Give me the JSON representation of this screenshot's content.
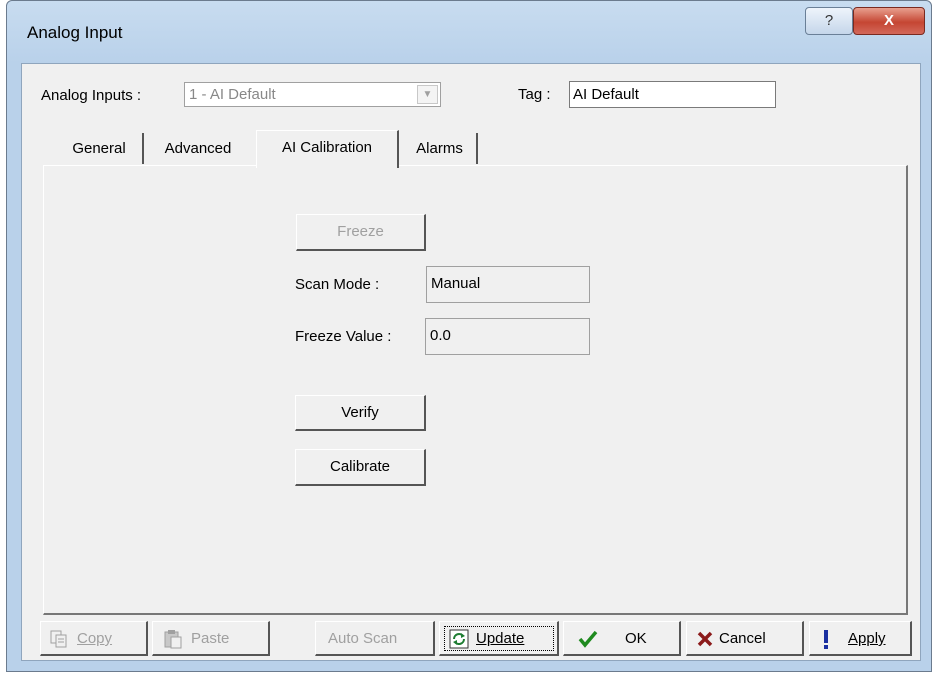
{
  "window": {
    "title": "Analog Input",
    "help_glyph": "?",
    "close_glyph": "X"
  },
  "header": {
    "analog_inputs_label": "Analog Inputs :",
    "analog_inputs_value": "1 - AI Default",
    "tag_label": "Tag :",
    "tag_value": "AI Default"
  },
  "tabs": [
    {
      "label": "General",
      "active": false
    },
    {
      "label": "Advanced",
      "active": false
    },
    {
      "label": "AI Calibration",
      "active": true
    },
    {
      "label": "Alarms",
      "active": false
    }
  ],
  "calibration": {
    "freeze_button": "Freeze",
    "scan_mode_label": "Scan Mode :",
    "scan_mode_value": "Manual",
    "freeze_value_label": "Freeze Value :",
    "freeze_value": "0.0",
    "verify_button": "Verify",
    "calibrate_button": "Calibrate"
  },
  "footer": {
    "copy": "Copy",
    "paste": "Paste",
    "auto_scan": "Auto Scan",
    "update": "Update",
    "ok": "OK",
    "cancel": "Cancel",
    "apply": "Apply"
  },
  "icons": {
    "copy": "copy-icon",
    "paste": "paste-icon",
    "update": "refresh-icon",
    "ok": "checkmark-icon",
    "cancel": "x-icon",
    "apply": "exclamation-icon"
  },
  "colors": {
    "titlebar": "#b9d1ea",
    "close_button": "#c54633",
    "ok_check": "#1f8a1f",
    "cancel_x": "#8b1a1a",
    "apply_mark": "#1a2fa0"
  }
}
